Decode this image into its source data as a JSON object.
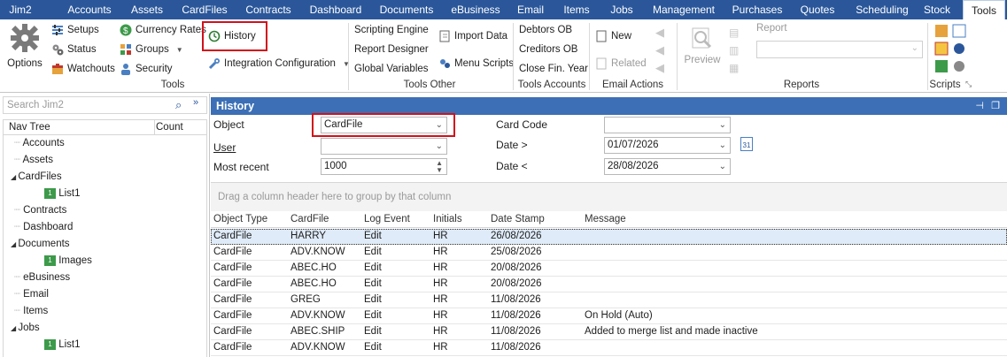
{
  "menu": [
    "Jim2",
    "Accounts",
    "Assets",
    "CardFiles",
    "Contracts",
    "Dashboard",
    "Documents",
    "eBusiness",
    "Email",
    "Items",
    "Jobs",
    "Management",
    "Purchases",
    "Quotes",
    "Scheduling",
    "Stock",
    "Tools"
  ],
  "ribbon": {
    "options": "Options",
    "setups": "Setups",
    "status": "Status",
    "watchouts": "Watchouts",
    "currency_rates": "Currency Rates",
    "groups": "Groups",
    "security": "Security",
    "history": "History",
    "integration": "Integration Configuration",
    "group_tools": "Tools",
    "scripting_engine": "Scripting Engine",
    "report_designer": "Report Designer",
    "global_variables": "Global Variables",
    "import_data": "Import Data",
    "menu_scripts": "Menu Scripts",
    "group_tools_other": "Tools Other",
    "debtors_ob": "Debtors OB",
    "creditors_ob": "Creditors OB",
    "close_fin_year": "Close Fin. Year",
    "group_tools_accounts": "Tools Accounts",
    "new": "New",
    "related": "Related",
    "group_email_actions": "Email Actions",
    "preview": "Preview",
    "report": "Report",
    "group_reports": "Reports",
    "group_scripts": "Scripts"
  },
  "nav": {
    "search_placeholder": "Search Jim2",
    "col_tree": "Nav Tree",
    "col_count": "Count",
    "items": [
      "Accounts",
      "Assets",
      "CardFiles",
      "List1",
      "Contracts",
      "Dashboard",
      "Documents",
      "Images",
      "eBusiness",
      "Email",
      "Items",
      "Jobs",
      "List1"
    ]
  },
  "history": {
    "title": "History",
    "object_label": "Object",
    "object_value": "CardFile",
    "user_label": "User",
    "user_value": "",
    "most_recent_label": "Most recent",
    "most_recent_value": "1000",
    "card_code_label": "Card Code",
    "card_code_value": "",
    "date_from_label": "Date >",
    "date_from_value": "01/07/2026",
    "date_to_label": "Date <",
    "date_to_value": "28/08/2026",
    "group_hint": "Drag a column header here to group by that column",
    "columns": [
      "Object Type",
      "CardFile",
      "Log Event",
      "Initials",
      "Date Stamp",
      "Message"
    ],
    "rows": [
      [
        "CardFile",
        "HARRY",
        "Edit",
        "HR",
        "26/08/2026",
        ""
      ],
      [
        "CardFile",
        "ADV.KNOW",
        "Edit",
        "HR",
        "25/08/2026",
        ""
      ],
      [
        "CardFile",
        "ABEC.HO",
        "Edit",
        "HR",
        "20/08/2026",
        ""
      ],
      [
        "CardFile",
        "ABEC.HO",
        "Edit",
        "HR",
        "20/08/2026",
        ""
      ],
      [
        "CardFile",
        "GREG",
        "Edit",
        "HR",
        "11/08/2026",
        ""
      ],
      [
        "CardFile",
        "ADV.KNOW",
        "Edit",
        "HR",
        "11/08/2026",
        "On Hold (Auto)"
      ],
      [
        "CardFile",
        "ABEC.SHIP",
        "Edit",
        "HR",
        "11/08/2026",
        "Added to merge list and made inactive"
      ],
      [
        "CardFile",
        "ADV.KNOW",
        "Edit",
        "HR",
        "11/08/2026",
        ""
      ]
    ]
  },
  "colors": {
    "menubar": "#2b579a",
    "header": "#3c6fb5",
    "highlight": "#d0111b"
  }
}
